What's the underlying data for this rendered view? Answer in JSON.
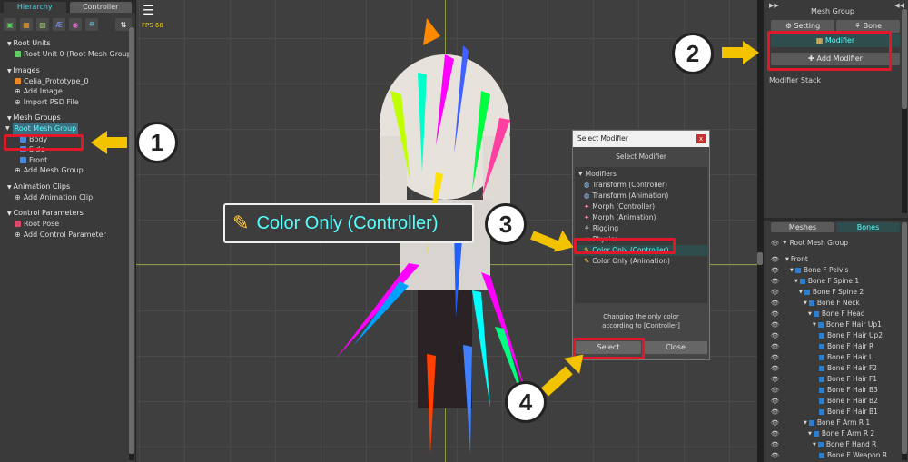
{
  "left": {
    "tabs": [
      "Hierarchy",
      "Controller"
    ],
    "tools": [
      "▣",
      "▦",
      "▨",
      "Æ",
      "◉",
      "⛯",
      "⇅"
    ],
    "sections": [
      {
        "title": "Root Units",
        "items": [
          "Root Unit 0 (Root Mesh Group)"
        ]
      },
      {
        "title": "Images",
        "items": [
          "Celia_Prototype_0",
          "Add Image",
          "Import PSD File"
        ]
      },
      {
        "title": "Mesh Groups",
        "items": [
          "Root Mesh Group",
          "Body",
          "Side",
          "Front",
          "Add Mesh Group"
        ]
      },
      {
        "title": "Animation Clips",
        "items": [
          "Add Animation Clip"
        ]
      },
      {
        "title": "Control Parameters",
        "items": [
          "Root Pose",
          "Add Control Parameter"
        ]
      }
    ]
  },
  "viewport": {
    "fps": "FPS 68",
    "menu_icon": "hamburger-icon"
  },
  "right": {
    "header": "Mesh Group",
    "buttons": {
      "setting": "Setting",
      "bone": "Bone",
      "modifier": "Modifier",
      "add_modifier": "Add Modifier"
    },
    "modifier_stack": "Modifier Stack",
    "lower_tabs": [
      "Meshes",
      "Bones"
    ],
    "root": "Root Mesh Group",
    "bones": [
      {
        "label": "Front",
        "indent": 0
      },
      {
        "label": "Bone F Pelvis",
        "indent": 1
      },
      {
        "label": "Bone F Spine 1",
        "indent": 2
      },
      {
        "label": "Bone F Spine 2",
        "indent": 3
      },
      {
        "label": "Bone F Neck",
        "indent": 4
      },
      {
        "label": "Bone F Head",
        "indent": 5
      },
      {
        "label": "Bone F Hair Up1",
        "indent": 6
      },
      {
        "label": "Bone F Hair Up2",
        "indent": 7
      },
      {
        "label": "Bone F Hair R",
        "indent": 7
      },
      {
        "label": "Bone F Hair L",
        "indent": 7
      },
      {
        "label": "Bone F Hair F2",
        "indent": 7
      },
      {
        "label": "Bone F Hair F1",
        "indent": 7
      },
      {
        "label": "Bone F Hair B3",
        "indent": 7
      },
      {
        "label": "Bone F Hair B2",
        "indent": 7
      },
      {
        "label": "Bone F Hair B1",
        "indent": 7
      },
      {
        "label": "Bone F Arm R 1",
        "indent": 4
      },
      {
        "label": "Bone F Arm R 2",
        "indent": 5
      },
      {
        "label": "Bone F Hand R",
        "indent": 6
      },
      {
        "label": "Bone F Weapon R",
        "indent": 7
      }
    ]
  },
  "dialog": {
    "title": "Select Modifier",
    "subtitle": "Select Modifier",
    "group": "Modifiers",
    "items": [
      "Transform (Controller)",
      "Transform (Animation)",
      "Morph (Controller)",
      "Morph (Animation)",
      "Rigging",
      "Physics",
      "Color Only (Controller)",
      "Color Only (Animation)"
    ],
    "description": "Changing the only color\naccording to [Controller]",
    "select": "Select",
    "close": "Close"
  },
  "callout": {
    "label": "Color Only (Controller)",
    "numbers": [
      "1",
      "2",
      "3",
      "4"
    ]
  },
  "colors": {
    "accent": "#4fd3e0",
    "highlight": "#e0182a",
    "arrow": "#f3c300"
  }
}
